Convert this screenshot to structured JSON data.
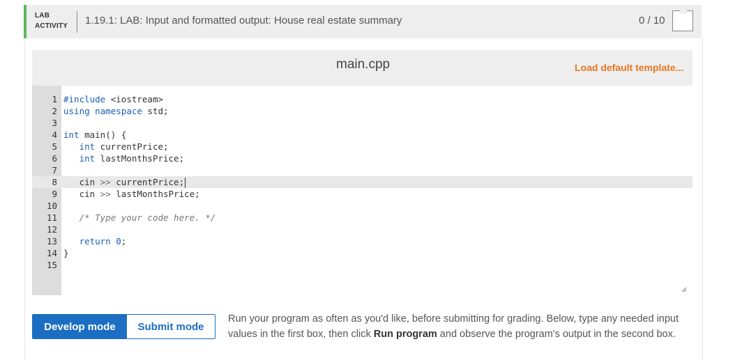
{
  "lab_header": {
    "tag_line1": "LAB",
    "tag_line2": "ACTIVITY",
    "title": "1.19.1: LAB: Input and formatted output: House real estate summary",
    "score": "0 / 10",
    "accent_color": "#5cb85c"
  },
  "editor": {
    "file_name": "main.cpp",
    "load_template_label": "Load default template...",
    "lines": [
      {
        "n": "1",
        "text": "#include <iostream>"
      },
      {
        "n": "2",
        "text": "using namespace std;"
      },
      {
        "n": "3",
        "text": ""
      },
      {
        "n": "4",
        "text": "int main() {"
      },
      {
        "n": "5",
        "text": "   int currentPrice;"
      },
      {
        "n": "6",
        "text": "   int lastMonthsPrice;"
      },
      {
        "n": "7",
        "text": ""
      },
      {
        "n": "8",
        "text": "   cin >> currentPrice;"
      },
      {
        "n": "9",
        "text": "   cin >> lastMonthsPrice;"
      },
      {
        "n": "10",
        "text": ""
      },
      {
        "n": "11",
        "text": "   /* Type your code here. */"
      },
      {
        "n": "12",
        "text": ""
      },
      {
        "n": "13",
        "text": "   return 0;"
      },
      {
        "n": "14",
        "text": "}"
      },
      {
        "n": "15",
        "text": ""
      }
    ],
    "active_line": "8"
  },
  "modes": {
    "develop_label": "Develop mode",
    "submit_label": "Submit mode",
    "active": "develop",
    "accent_color": "#1b6ec2"
  },
  "instructions": {
    "part1": "Run your program as often as you'd like, before submitting for grading. Below, type any needed input values in the first box, then click ",
    "run_label": "Run program",
    "part2": " and observe the program's output in the second box."
  }
}
